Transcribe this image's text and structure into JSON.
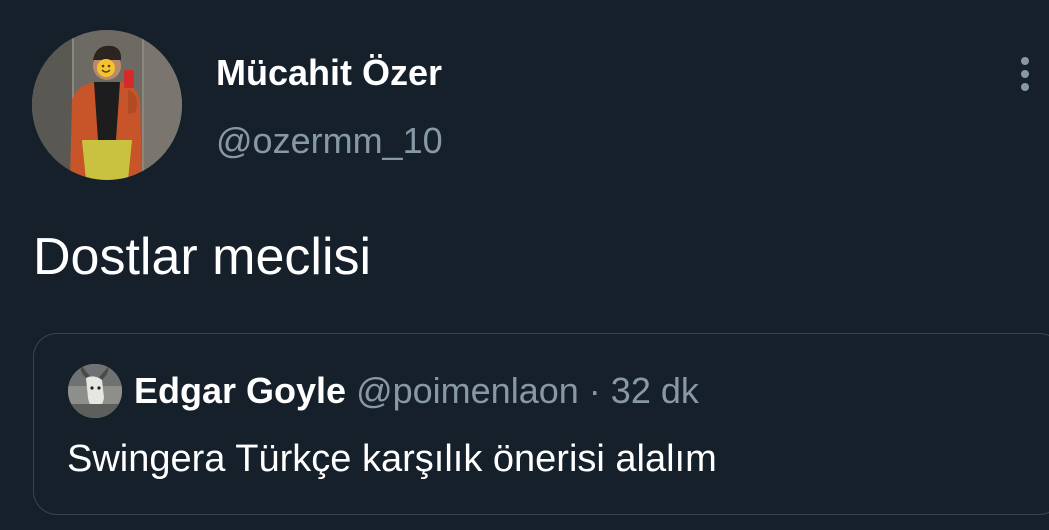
{
  "tweet": {
    "author": {
      "display_name": "Mücahit Özer",
      "handle": "@ozermm_10",
      "avatar_icon": "profile-photo"
    },
    "text": "Dostlar meclisi",
    "menu_icon": "more-vertical-icon"
  },
  "quoted_tweet": {
    "author": {
      "display_name": "Edgar Goyle",
      "handle": "@poimenlaon",
      "avatar_icon": "profile-photo"
    },
    "separator": "·",
    "time": "32 dk",
    "text": "Swingera Türkçe karşılık önerisi alalım"
  },
  "colors": {
    "background": "#15202b",
    "primary_text": "#ffffff",
    "secondary_text": "#8899a6",
    "border": "#38444d"
  }
}
